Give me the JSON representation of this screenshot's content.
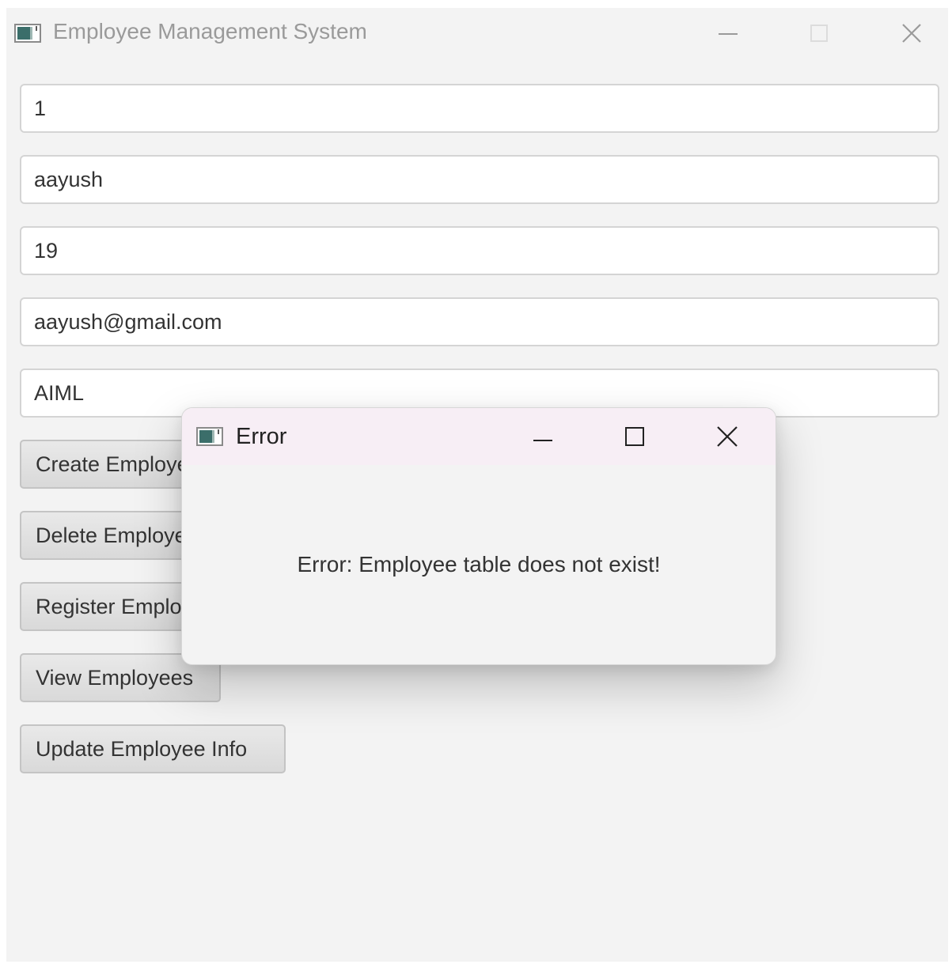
{
  "window": {
    "title": "Employee Management System"
  },
  "form": {
    "id_value": "1",
    "name_value": "aayush",
    "age_value": "19",
    "email_value": "aayush@gmail.com",
    "department_value": "AIML"
  },
  "buttons": {
    "create": "Create Employee",
    "delete": "Delete Employee",
    "register": "Register Employee",
    "view": "View Employees",
    "update": "Update Employee Info"
  },
  "dialog": {
    "title": "Error",
    "message": "Error: Employee table does not exist!"
  },
  "icons": {
    "app": "app-window-icon",
    "minimize": "minimize-icon",
    "maximize": "maximize-icon",
    "close": "close-icon"
  },
  "colors": {
    "window_bg": "#f3f3f3",
    "dialog_titlebar_bg": "#f7eef5",
    "field_border": "#d4d4d4"
  }
}
